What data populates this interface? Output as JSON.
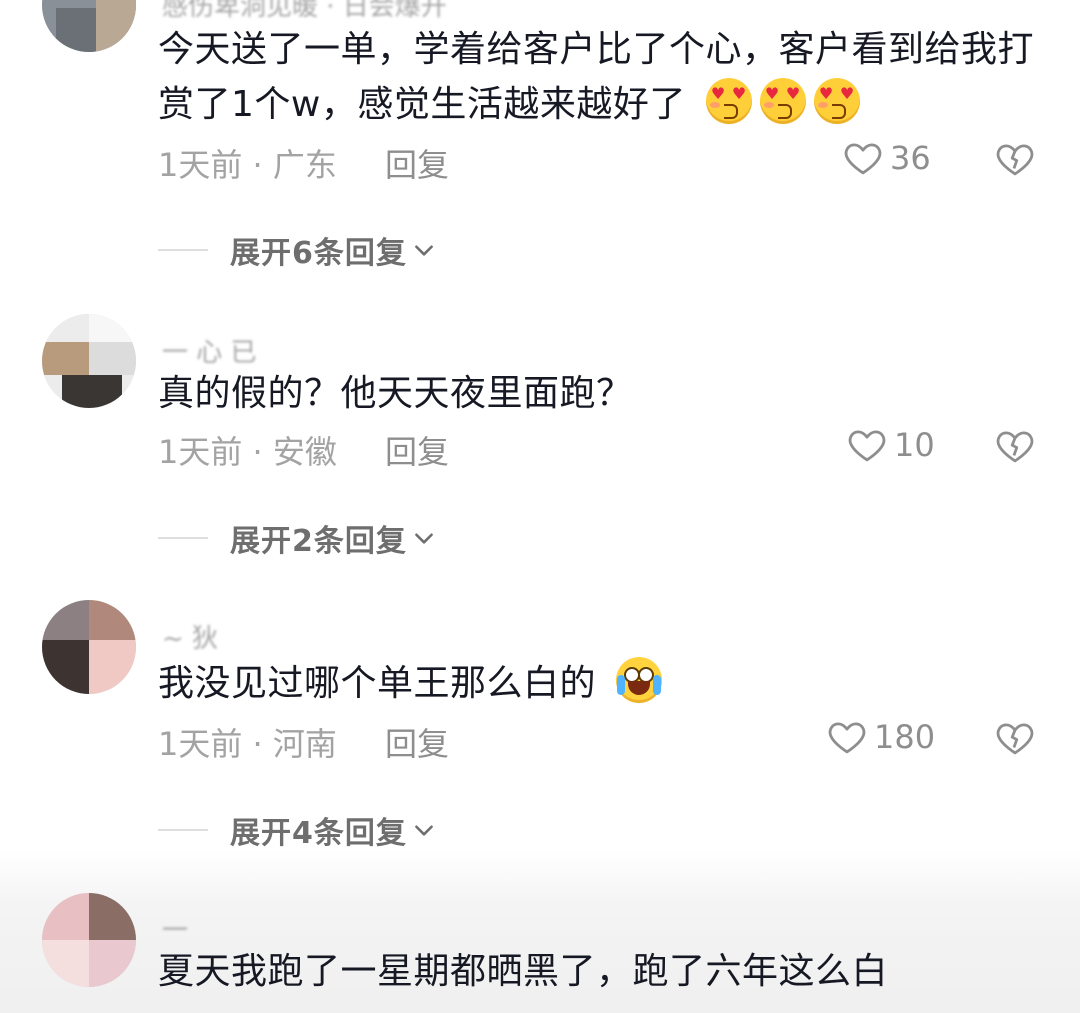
{
  "comments": [
    {
      "username": "感伤卑洞见暖 · 日会爆开",
      "text": "今天送了一单，学着给客户比了个心，客户看到给我打赏了1个w，感觉生活越来越好了",
      "meta": "1天前 · 广东",
      "reply": "回复",
      "likes": "36",
      "expand": "展开6条回复",
      "emoji": [
        "smiling-face-with-heart-eyes",
        "smiling-face-with-heart-eyes",
        "smiling-face-with-heart-eyes"
      ]
    },
    {
      "username": "一 心 已",
      "text": "真的假的？他天天夜里面跑？",
      "meta": "1天前 · 安徽",
      "reply": "回复",
      "likes": "10",
      "expand": "展开2条回复"
    },
    {
      "username": "~ 狄",
      "text": "我没见过哪个单王那么白的",
      "meta": "1天前 · 河南",
      "reply": "回复",
      "likes": "180",
      "expand": "展开4条回复",
      "emoji": [
        "face-with-tears-of-joy"
      ]
    },
    {
      "username": "一",
      "text": "夏天我跑了一星期都晒黑了，跑了六年这么白",
      "meta": "",
      "reply": "",
      "likes": ""
    }
  ]
}
